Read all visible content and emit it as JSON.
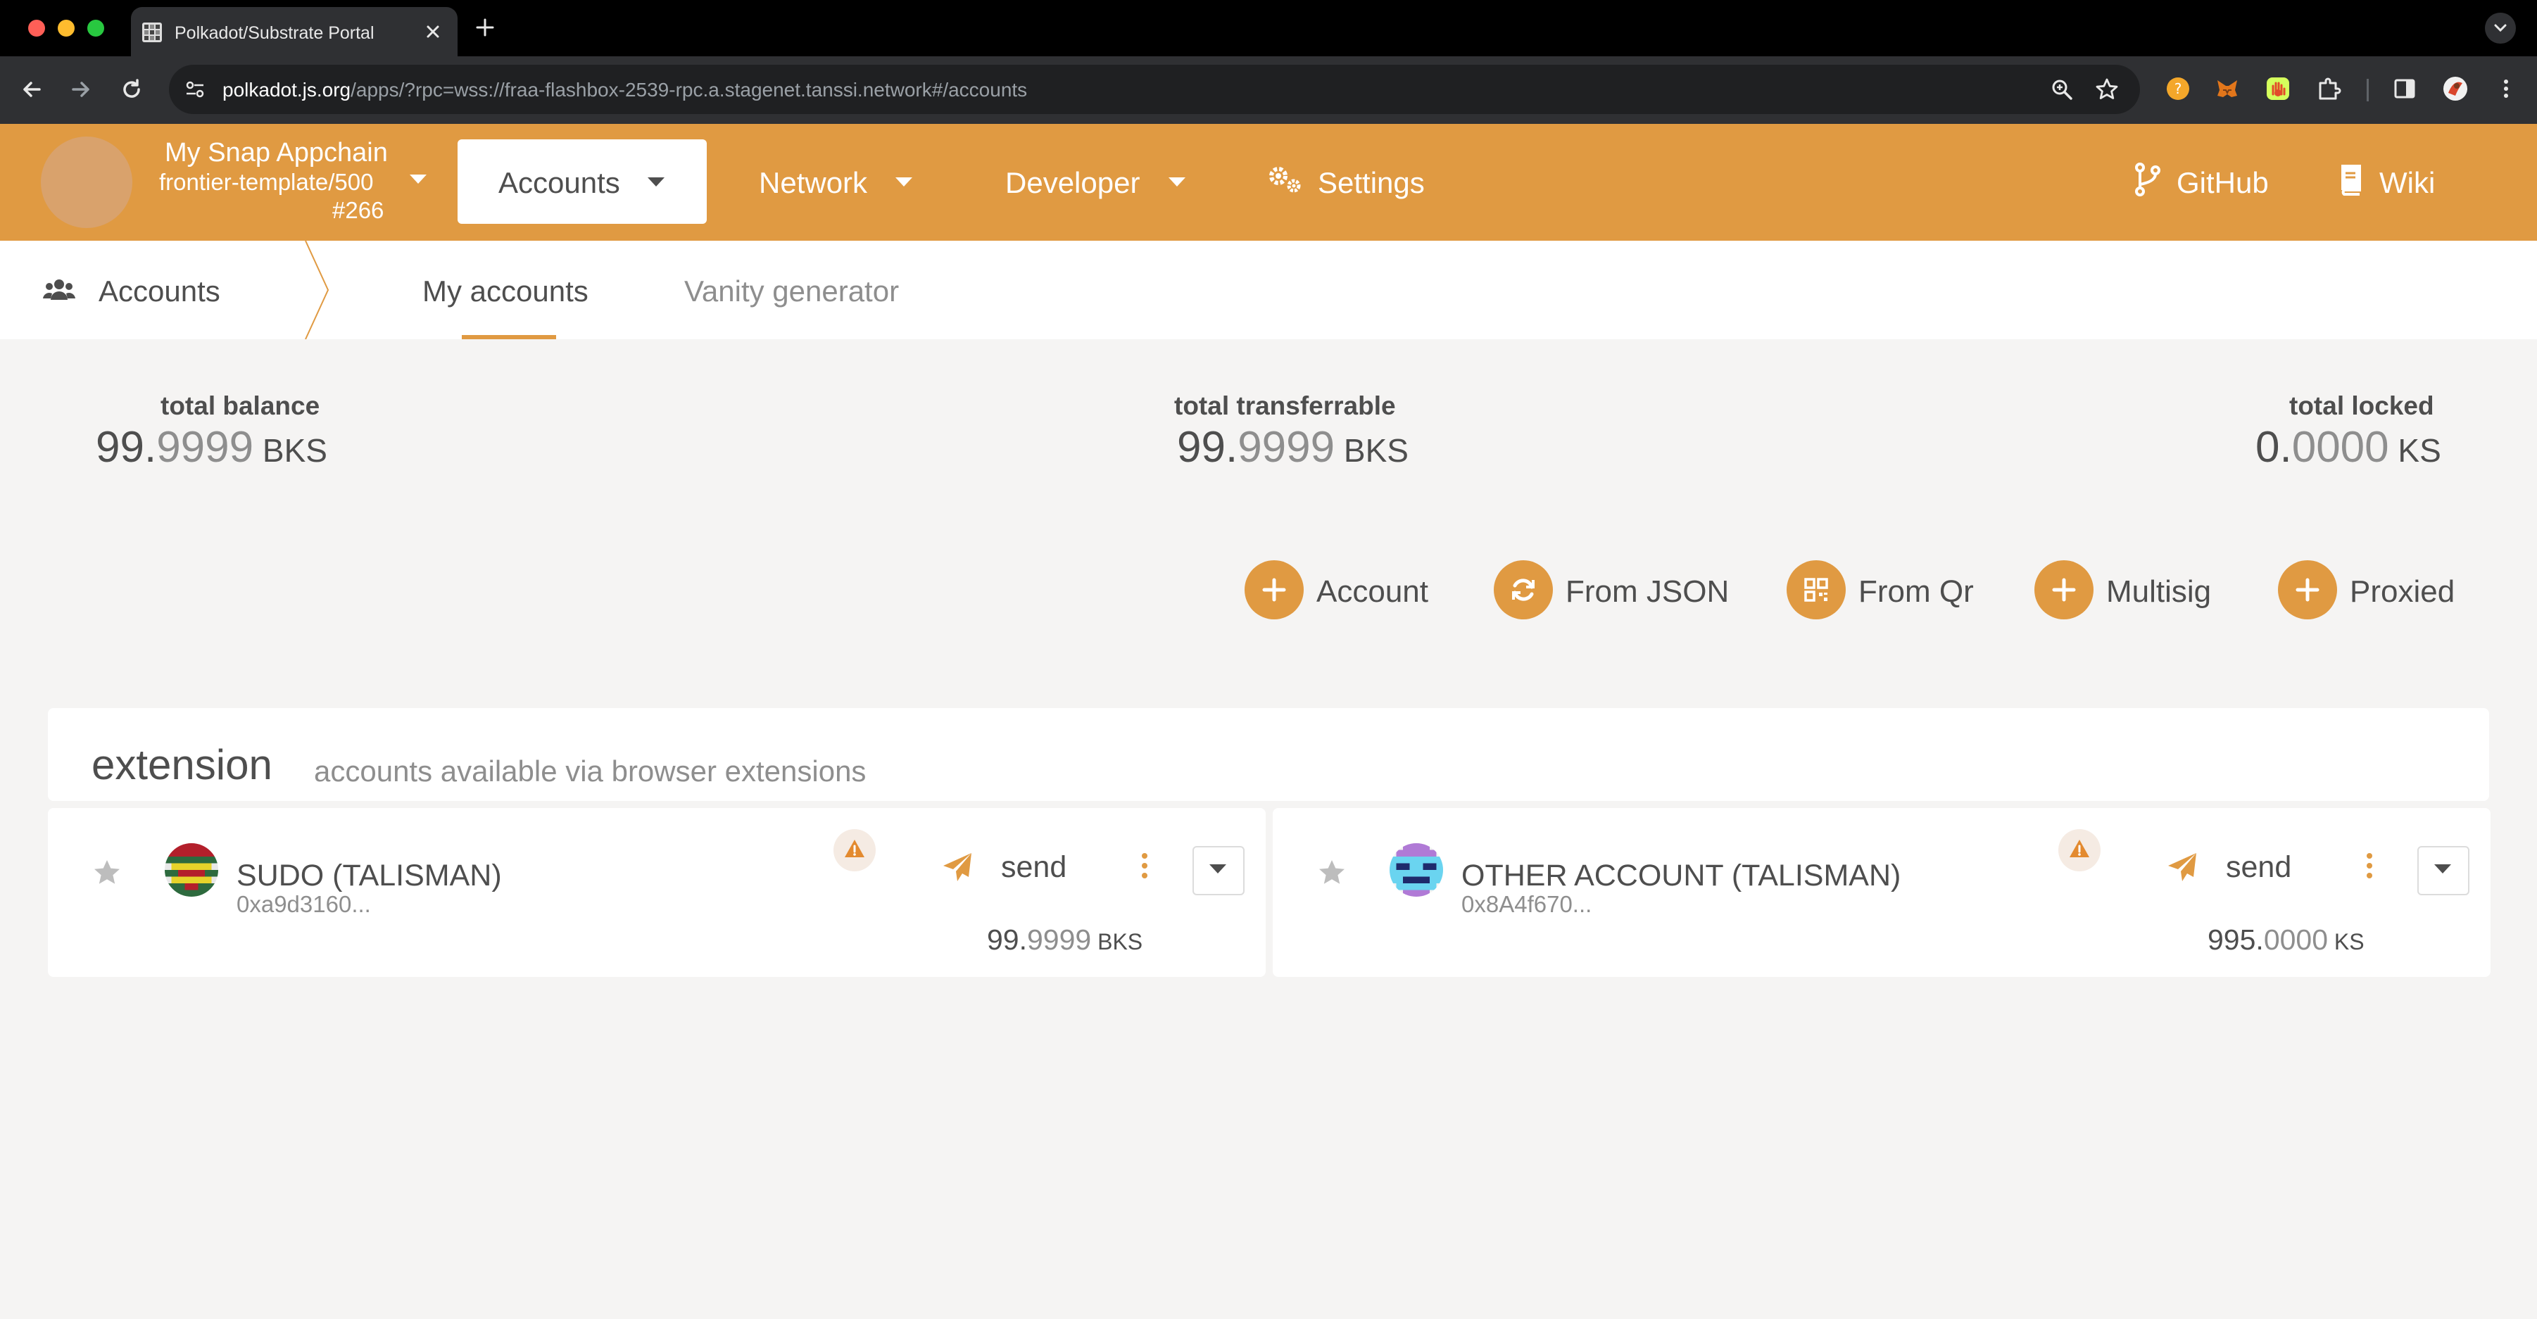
{
  "browser": {
    "tab_title": "Polkadot/Substrate Portal",
    "url_host": "polkadot.js.org",
    "url_path": "/apps/?rpc=wss://fraa-flashbox-2539-rpc.a.stagenet.tanssi.network#/accounts",
    "traffic_colors": [
      "#ff5f57",
      "#febc2e",
      "#28c840"
    ]
  },
  "chain": {
    "name": "My Snap Appchain",
    "spec": "frontier-template/500",
    "block": "#266"
  },
  "menu": {
    "accounts": "Accounts",
    "network": "Network",
    "developer": "Developer",
    "settings": "Settings",
    "github": "GitHub",
    "wiki": "Wiki"
  },
  "subnav": {
    "title": "Accounts",
    "tabs": [
      "My accounts",
      "Vanity generator"
    ],
    "active_tab": 0
  },
  "summary": {
    "total_balance": {
      "label": "total balance",
      "int": "99.",
      "dec": "9999",
      "unit": " BKS"
    },
    "total_transferrable": {
      "label": "total transferrable",
      "int": "99.",
      "dec": "9999",
      "unit": " BKS"
    },
    "total_locked": {
      "label": "total locked",
      "int": "0.",
      "dec": "0000",
      "unit": " KS"
    }
  },
  "actions": [
    "Account",
    "From JSON",
    "From Qr",
    "Multisig",
    "Proxied"
  ],
  "extension": {
    "title": "extension",
    "subtitle": "accounts available via browser extensions"
  },
  "accounts": [
    {
      "name": "SUDO (TALISMAN)",
      "address": "0xa9d3160...",
      "send_label": "send",
      "bal_int": "99.",
      "bal_dec": "9999",
      "bal_unit": " BKS"
    },
    {
      "name": "OTHER ACCOUNT (TALISMAN)",
      "address": "0x8A4f670...",
      "send_label": "send",
      "bal_int": "995.",
      "bal_dec": "0000",
      "bal_unit": " KS"
    }
  ],
  "colors": {
    "brand": "#e09a42",
    "text": "#4e4e4e",
    "muted": "#8e8e8e",
    "background": "#f5f4f3"
  }
}
